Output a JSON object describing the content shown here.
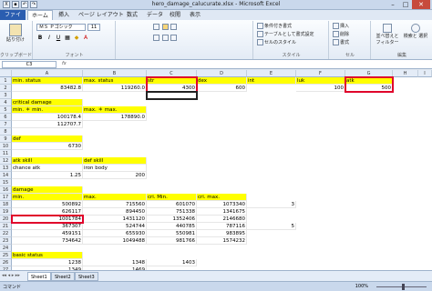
{
  "window": {
    "title": "hero_damage_calucurate.xlsx - Microsoft Excel"
  },
  "tabs": [
    "ファイル",
    "ホーム",
    "挿入",
    "ページ レイアウト",
    "数式",
    "データ",
    "校閲",
    "表示"
  ],
  "ribbon": {
    "paste": "貼り付け",
    "clipboard": "クリップボード",
    "font_name": "ＭＳ Ｐゴシック",
    "font_size": "11",
    "font_group": "フォント",
    "cond_format": "条件付き書式",
    "table_format": "テーブルとして書式設定",
    "cell_style": "セルのスタイル",
    "style_group": "スタイル",
    "insert": "挿入",
    "delete": "削除",
    "format": "書式",
    "cells_group": "セル",
    "sort": "並べ替えと フィルター",
    "find": "検索と 選択",
    "edit_group": "編集"
  },
  "namebox": "C3",
  "columns": [
    "A",
    "B",
    "C",
    "D",
    "E",
    "F",
    "G",
    "H",
    "I"
  ],
  "rows": [
    "1",
    "2",
    "3",
    "4",
    "5",
    "6",
    "7",
    "8",
    "9",
    "10",
    "11",
    "12",
    "13",
    "14",
    "15",
    "16",
    "17",
    "18",
    "19",
    "20",
    "21",
    "22",
    "23",
    "24",
    "25",
    "26",
    "27"
  ],
  "cells": {
    "A1": "min. status",
    "B1": "max. status",
    "C1": "str",
    "D1": "dex",
    "E1": "int",
    "F1": "luk",
    "G1": "atk",
    "A2": "83482.8",
    "B2": "119260.0",
    "C2": "4300",
    "D2": "600",
    "F2": "100",
    "G2": "500",
    "A4": "critical damage",
    "A5": "min. ＊ min.",
    "B5": "max. ＊ max.",
    "A6": "100178.4",
    "B6": "178890.0",
    "A7": "112707.7",
    "A9": "def",
    "A10": "6730",
    "A12": "atk skill",
    "B12": "def skill",
    "A13": "chance atk",
    "B13": "iron body",
    "A14": "1.25",
    "B14": "200",
    "A16": "damage",
    "A17": "min.",
    "B17": "max.",
    "C17": "cri. Min.",
    "D17": "cri. max.",
    "A18": "500892",
    "B18": "715560",
    "C18": "601070",
    "D18": "1073340",
    "E18": "3",
    "A19": "626117",
    "B19": "894450",
    "C19": "751338",
    "D19": "1341675",
    "A20": "1001784",
    "B20": "1431120",
    "C20": "1352406",
    "D20": "2146680",
    "A21": "367307",
    "B21": "524744",
    "C21": "440785",
    "D21": "787116",
    "E21": "5",
    "A22": "459151",
    "B22": "655930",
    "C22": "550981",
    "D22": "983895",
    "A23": "734642",
    "B23": "1049488",
    "C23": "981766",
    "D23": "1574232",
    "A25": "basic status",
    "A26": "1238",
    "B26": "1348",
    "C26": "1403",
    "A27": "1349",
    "B27": "1469"
  },
  "sheets": [
    "Sheet1",
    "Sheet2",
    "Sheet3"
  ],
  "status": {
    "mode": "コマンド",
    "zoom": "100%"
  }
}
